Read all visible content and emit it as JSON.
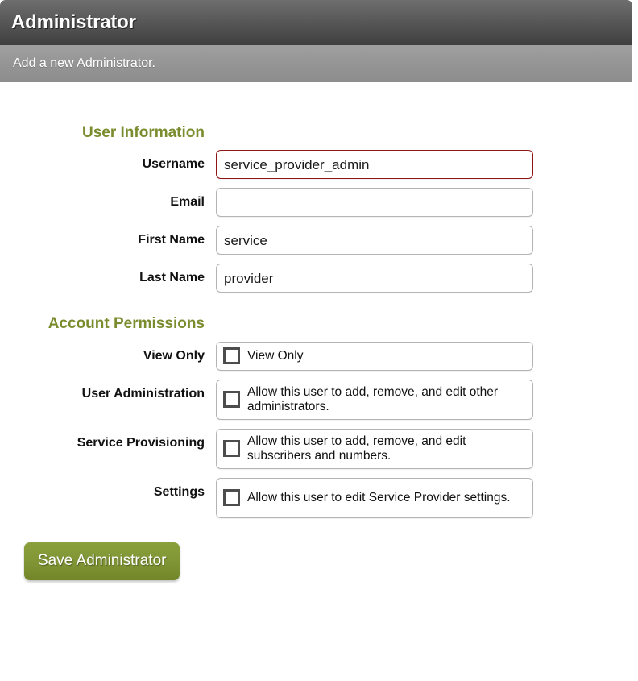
{
  "header": {
    "title": "Administrator",
    "subtitle": "Add a new Administrator."
  },
  "sections": {
    "user_information": {
      "heading": "User Information",
      "fields": [
        {
          "label": "Username",
          "value": "service_provider_admin",
          "placeholder": "",
          "error": true
        },
        {
          "label": "Email",
          "value": "",
          "placeholder": "",
          "error": false
        },
        {
          "label": "First Name",
          "value": "service",
          "placeholder": "",
          "error": false
        },
        {
          "label": "Last Name",
          "value": "provider",
          "placeholder": "",
          "error": false
        }
      ]
    },
    "account_permissions": {
      "heading": "Account Permissions",
      "permissions": [
        {
          "label": "View Only",
          "description": "View Only",
          "checked": false
        },
        {
          "label": "User Administration",
          "description": "Allow this user to add, remove, and edit other administrators.",
          "checked": false
        },
        {
          "label": "Service Provisioning",
          "description": "Allow this user to add, remove, and edit subscribers and numbers.",
          "checked": false
        },
        {
          "label": "Settings",
          "description": "Allow this user to edit Service Provider settings.",
          "checked": false
        }
      ]
    }
  },
  "actions": {
    "save_label": "Save Administrator"
  },
  "colors": {
    "accent_green": "#7b8c2e",
    "button_green": "#7f9434",
    "error_red": "#8e1616",
    "header_dark": "#4a4a4a",
    "subheader_gray": "#949494"
  }
}
